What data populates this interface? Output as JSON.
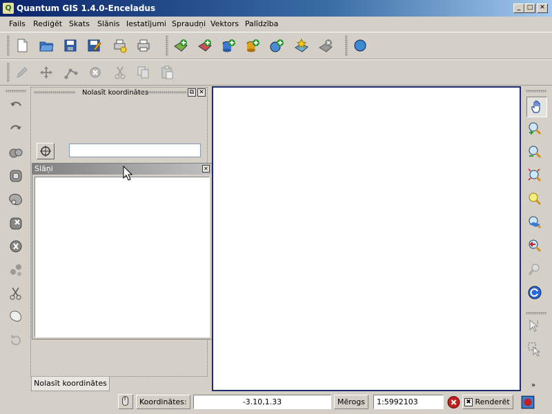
{
  "window": {
    "title": "Quantum GIS 1.4.0-Enceladus",
    "app_icon": "Q",
    "controls": {
      "minimize": "_",
      "maximize": "□",
      "close": "✕"
    }
  },
  "menu": [
    "Fails",
    "Rediģēt",
    "Skats",
    "Slānis",
    "Iestatījumi",
    "Spraudņi",
    "Vektors",
    "Palīdzība"
  ],
  "toolbar_icons": {
    "file": [
      "new-project-icon",
      "open-project-icon",
      "save-project-icon",
      "save-as-icon",
      "new-print-composer-icon",
      "print-icon"
    ],
    "layers": [
      "add-vector-layer-icon",
      "add-raster-layer-icon",
      "add-postgis-layer-icon",
      "add-spatialite-layer-icon",
      "add-wms-layer-icon",
      "new-vector-layer-icon",
      "remove-layer-icon"
    ],
    "web": [
      "globe-icon"
    ],
    "digitize": [
      "toggle-editing-icon",
      "move-feature-icon",
      "node-tool-icon",
      "delete-selected-icon",
      "cut-features-icon",
      "copy-features-icon",
      "paste-features-icon"
    ],
    "advanced_edit": [
      "undo-icon",
      "redo-icon",
      "simplify-feature-icon",
      "add-ring-icon",
      "add-island-icon",
      "delete-ring-icon",
      "delete-part-icon",
      "reshape-icon",
      "split-features-icon",
      "merge-features-icon",
      "rotate-point-symbols-icon"
    ],
    "navigation": [
      "pan-icon",
      "zoom-in-icon",
      "zoom-out-icon",
      "zoom-full-icon",
      "zoom-to-selection-icon",
      "zoom-to-layer-icon",
      "zoom-last-icon",
      "zoom-actual-size-icon",
      "refresh-icon"
    ],
    "attributes": [
      "identify-icon",
      "select-icon"
    ]
  },
  "coord_dock": {
    "title": "Nolasīt koordinātes",
    "input_value": "",
    "tab_label": "Nolasīt koordinātes"
  },
  "layers_panel": {
    "title": "Slāņi",
    "close": "✕"
  },
  "statusbar": {
    "coordinates_label": "Koordinātes:",
    "coordinates_value": "-3.10,1.33",
    "scale_label": "Mērogs",
    "scale_value": "1:5992103",
    "render_label": "Renderēt",
    "render_checked": "✖"
  },
  "colors": {
    "title_bar_start": "#0a246a",
    "canvas_border": "#1a2d6e",
    "window_bg": "#d4d0c8"
  }
}
